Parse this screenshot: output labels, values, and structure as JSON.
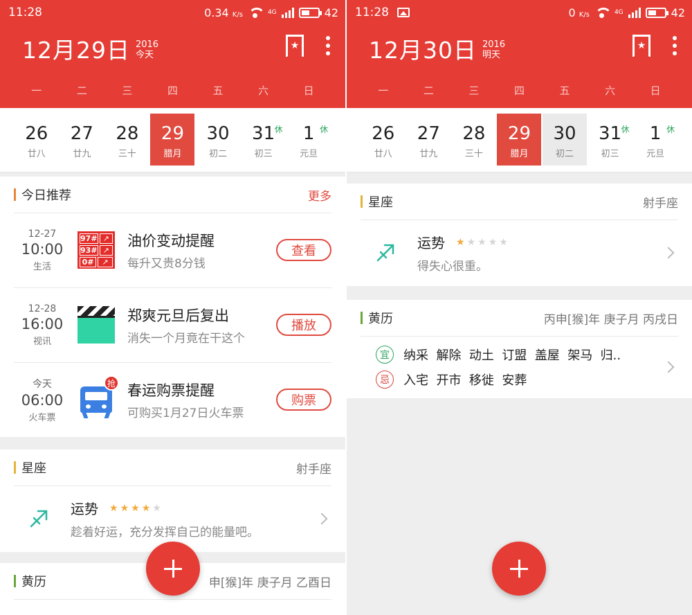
{
  "colors": {
    "brand_red": "#e53c35",
    "accent_orange": "#e8863a",
    "accent_yellow": "#e4b43a",
    "accent_green": "#6aa63a",
    "yi_green": "#2aa55d",
    "ji_red": "#d9443c"
  },
  "left": {
    "status": {
      "time": "11:28",
      "speed": "0.34",
      "speed_unit": "K/s",
      "net": "4G",
      "battery": "42"
    },
    "header": {
      "date": "12月29日",
      "year": "2016",
      "relative": "今天"
    },
    "weekdays": [
      "一",
      "二",
      "三",
      "四",
      "五",
      "六",
      "日"
    ],
    "days": [
      {
        "num": "26",
        "lunar": "廿八",
        "holiday": ""
      },
      {
        "num": "27",
        "lunar": "廿九",
        "holiday": ""
      },
      {
        "num": "28",
        "lunar": "三十",
        "holiday": ""
      },
      {
        "num": "29",
        "lunar": "腊月",
        "holiday": ""
      },
      {
        "num": "30",
        "lunar": "初二",
        "holiday": ""
      },
      {
        "num": "31",
        "lunar": "初三",
        "holiday": "休"
      },
      {
        "num": "1",
        "lunar": "元旦",
        "holiday": "休"
      }
    ],
    "recommend": {
      "title": "今日推荐",
      "more": "更多",
      "items": [
        {
          "date": "12-27",
          "time": "10:00",
          "category": "生活",
          "title": "油价变动提醒",
          "sub": "每升又贵8分钱",
          "action": "查看",
          "icon": "oil-price-icon"
        },
        {
          "date": "12-28",
          "time": "16:00",
          "category": "视讯",
          "title": "郑爽元旦后复出",
          "sub": "消失一个月竟在干这个",
          "action": "播放",
          "icon": "clapperboard-icon"
        },
        {
          "date": "今天",
          "time": "06:00",
          "category": "火车票",
          "title": "春运购票提醒",
          "sub": "可购买1月27日火车票",
          "action": "购票",
          "icon": "train-ticket-icon",
          "badge": "抢"
        }
      ],
      "oil": [
        {
          "grade": "97#"
        },
        {
          "grade": "93#"
        },
        {
          "grade": "0#"
        }
      ]
    },
    "zodiac": {
      "title": "星座",
      "sign": "射手座",
      "label": "运势",
      "stars": 4,
      "stars_max": 5,
      "desc": "趁着好运，充分发挥自己的能量吧。"
    },
    "almanac": {
      "title": "黄历",
      "ganzhi": "申[猴]年 庚子月 乙酉日"
    }
  },
  "right": {
    "status": {
      "time": "11:28",
      "speed": "0",
      "speed_unit": "K/s",
      "net": "4G",
      "battery": "42"
    },
    "header": {
      "date": "12月30日",
      "year": "2016",
      "relative": "明天"
    },
    "weekdays": [
      "一",
      "二",
      "三",
      "四",
      "五",
      "六",
      "日"
    ],
    "days": [
      {
        "num": "26",
        "lunar": "廿八",
        "holiday": ""
      },
      {
        "num": "27",
        "lunar": "廿九",
        "holiday": ""
      },
      {
        "num": "28",
        "lunar": "三十",
        "holiday": ""
      },
      {
        "num": "29",
        "lunar": "腊月",
        "holiday": ""
      },
      {
        "num": "30",
        "lunar": "初二",
        "holiday": ""
      },
      {
        "num": "31",
        "lunar": "初三",
        "holiday": "休"
      },
      {
        "num": "1",
        "lunar": "元旦",
        "holiday": "休"
      }
    ],
    "zodiac": {
      "title": "星座",
      "sign": "射手座",
      "label": "运势",
      "stars": 1,
      "stars_max": 5,
      "desc": "得失心很重。"
    },
    "almanac": {
      "title": "黄历",
      "ganzhi": "丙申[猴]年 庚子月 丙戌日",
      "yi_label": "宜",
      "ji_label": "忌",
      "yi": "纳采  解除  动土  订盟  盖屋  架马  归..",
      "ji": "入宅  开市  移徙  安葬"
    }
  }
}
